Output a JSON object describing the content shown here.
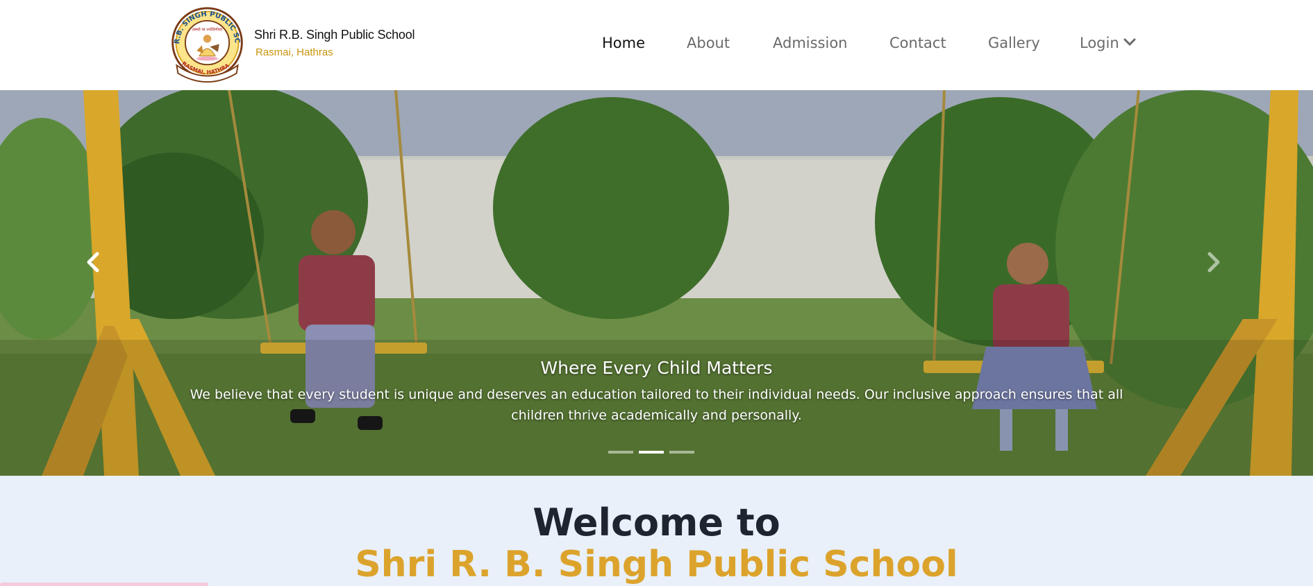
{
  "header": {
    "school_name": "Shri R.B. Singh Public School",
    "location": "Rasmai, Hathras",
    "seal": {
      "top_text": "SHRI R.B. SINGH PUBLIC SCHOOL",
      "bottom_text": "RASMAI, HATHRAS",
      "hindi_text": "तमसो मा ज्योतिर्गमय"
    }
  },
  "nav": {
    "items": [
      {
        "label": "Home",
        "active": true
      },
      {
        "label": "About"
      },
      {
        "label": "Admission"
      },
      {
        "label": "Contact"
      },
      {
        "label": "Gallery"
      },
      {
        "label": "Login",
        "icon": "chevron-down-icon"
      }
    ]
  },
  "carousel": {
    "title": "Where Every Child Matters",
    "text": "We believe that every student is unique and deserves an education tailored to their individual needs. Our inclusive approach ensures that all children thrive academically and personally.",
    "slide_count": 3,
    "active_slide": 2,
    "prev_icon": "chevron-left-icon",
    "next_icon": "chevron-right-icon"
  },
  "welcome": {
    "line1": "Welcome to",
    "line2": "Shri R. B. Singh Public School"
  },
  "colors": {
    "accent": "#dca32c",
    "brand_sub": "#c9930e",
    "nav_text": "#6a6a6a",
    "nav_active": "#111111",
    "welcome_bg": "#e9f0f9"
  }
}
